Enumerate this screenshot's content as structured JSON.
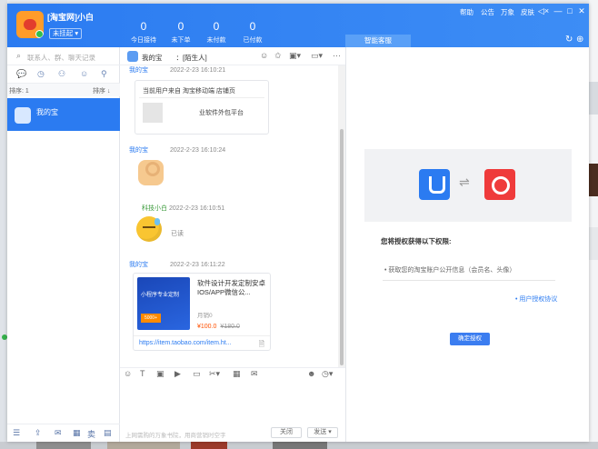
{
  "header": {
    "username": "[淘宝网]小白",
    "status": "未挂起 ▾",
    "stats": [
      {
        "value": "0",
        "label": "今日接待"
      },
      {
        "value": "0",
        "label": "未下单"
      },
      {
        "value": "0",
        "label": "未付款"
      },
      {
        "value": "0",
        "label": "已付款"
      }
    ],
    "menu": [
      "帮助",
      "公告",
      "万象",
      "皮肤"
    ],
    "controls": {
      "volume": "◁×",
      "minimize": "—",
      "maximize": "□",
      "close": "✕"
    },
    "agent_tab": "智能客服",
    "right_icons": [
      "↻",
      "⊕"
    ]
  },
  "left": {
    "search_placeholder": "联系人、群、聊天记录",
    "sort_left": "排序: 1",
    "sort_right": "排序 ↓",
    "contact_name": "我的宝"
  },
  "chat": {
    "title": "我的宝　　：[陌生人]",
    "messages": [
      {
        "sender": "我的宝",
        "time": "2022-2-23 16:10:21"
      },
      {
        "sender": "我的宝",
        "time": "2022-2-23 16:10:24"
      },
      {
        "sender": "科技小白",
        "time": "2022-2-23 16:10:51"
      },
      {
        "sender": "我的宝",
        "time": "2022-2-23 16:11:22"
      }
    ],
    "card1_line1": "当前用户来自 淘宝移动端 店铺页",
    "card1_line2": "业软件外包平台",
    "read_label": "已读",
    "product": {
      "image_text": "小程序专业定制",
      "image_button": "5000+",
      "title": "软件设计开发定制安卓IOS/APP微信公...",
      "sales": "月销0",
      "price": "¥100.0",
      "old_price": "¥180.0",
      "url": "https://item.taobao.com/item.ht..."
    },
    "footer_hint": "上网需购的万象书院，用商营销时空字",
    "close_button": "关闭",
    "send_button": "发送 ▾"
  },
  "auth": {
    "swap_glyph": "⇌",
    "title": "您将授权获得以下权限:",
    "item": "获取您的淘宝账户公开信息（会员名、头像）",
    "protocol": "用户授权协议",
    "confirm": "确定授权"
  },
  "colors": {
    "accent": "#2b7bf1",
    "price": "#ff5000"
  }
}
